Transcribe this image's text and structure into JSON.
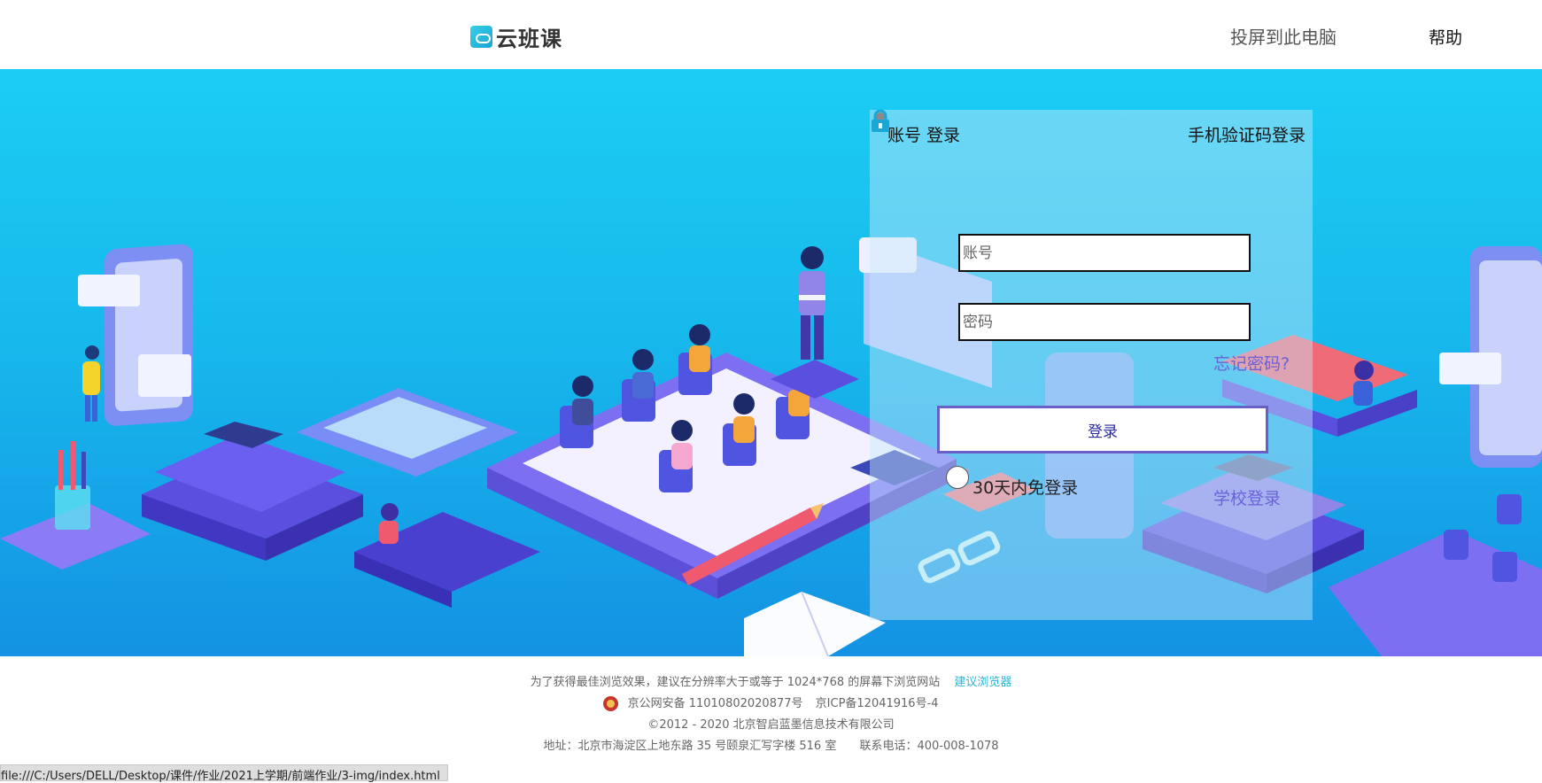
{
  "header": {
    "logo_text": "云班课",
    "cast_label": "投屏到此电脑",
    "help_label": "帮助"
  },
  "login": {
    "tab_account": "账号 登录",
    "tab_phone": "手机验证码登录",
    "account_placeholder": "账号",
    "password_placeholder": "密码",
    "forgot_label": "忘记密码?",
    "login_button": "登录",
    "remember_label": "30天内免登录",
    "school_login": "学校登录"
  },
  "footer": {
    "browser_note": "为了获得最佳浏览效果，建议在分辨率大于或等于 1024*768 的屏幕下浏览网站",
    "browser_link": "建议浏览器",
    "police_record": "京公网安备 11010802020877号",
    "icp_record": "京ICP备12041916号-4",
    "copyright": "©2012 - 2020 北京智启蓝墨信息技术有限公司",
    "address": "地址：北京市海淀区上地东路 35 号颐泉汇写字楼 516 室",
    "phone": "联系电话：400-008-1078"
  },
  "status_bar": {
    "url": "file:///C:/Users/DELL/Desktop/课件/作业/2021上学期/前端作业/3-img/index.html"
  },
  "colors": {
    "accent": "#6b62d8",
    "hero_top": "#1ccdf3",
    "hero_bottom": "#1492e3"
  }
}
